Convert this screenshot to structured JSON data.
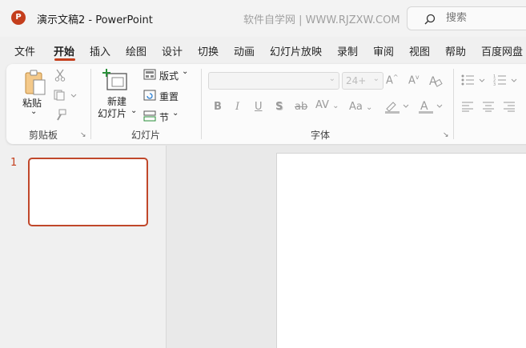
{
  "app": {
    "logo_letter": "P",
    "title": "演示文稿2  -  PowerPoint",
    "watermark": "软件自学网 | WWW.RJZXW.COM"
  },
  "search": {
    "placeholder": "搜索"
  },
  "tabs": [
    {
      "label": "文件"
    },
    {
      "label": "开始"
    },
    {
      "label": "插入"
    },
    {
      "label": "绘图"
    },
    {
      "label": "设计"
    },
    {
      "label": "切换"
    },
    {
      "label": "动画"
    },
    {
      "label": "幻灯片放映"
    },
    {
      "label": "录制"
    },
    {
      "label": "审阅"
    },
    {
      "label": "视图"
    },
    {
      "label": "帮助"
    },
    {
      "label": "百度网盘"
    }
  ],
  "active_tab": "开始",
  "ribbon": {
    "clipboard": {
      "paste": "粘贴",
      "paste_arrow": "⌄",
      "group": "剪贴板"
    },
    "slides": {
      "new_slide_l1": "新建",
      "new_slide_l2": "幻灯片",
      "layout": "版式",
      "reset": "重置",
      "section": "节",
      "group": "幻灯片"
    },
    "font": {
      "size": "24+",
      "group": "字体",
      "bold": "B",
      "italic": "I",
      "underline": "U",
      "shadow": "S",
      "strike": "ab",
      "spacing": "AV",
      "case": "Aa",
      "grow": "A",
      "shrink": "A"
    }
  },
  "thumbnails": [
    {
      "number": "1"
    }
  ],
  "colors": {
    "accent": "#c43e1c",
    "thumb_border": "#c0472a"
  }
}
